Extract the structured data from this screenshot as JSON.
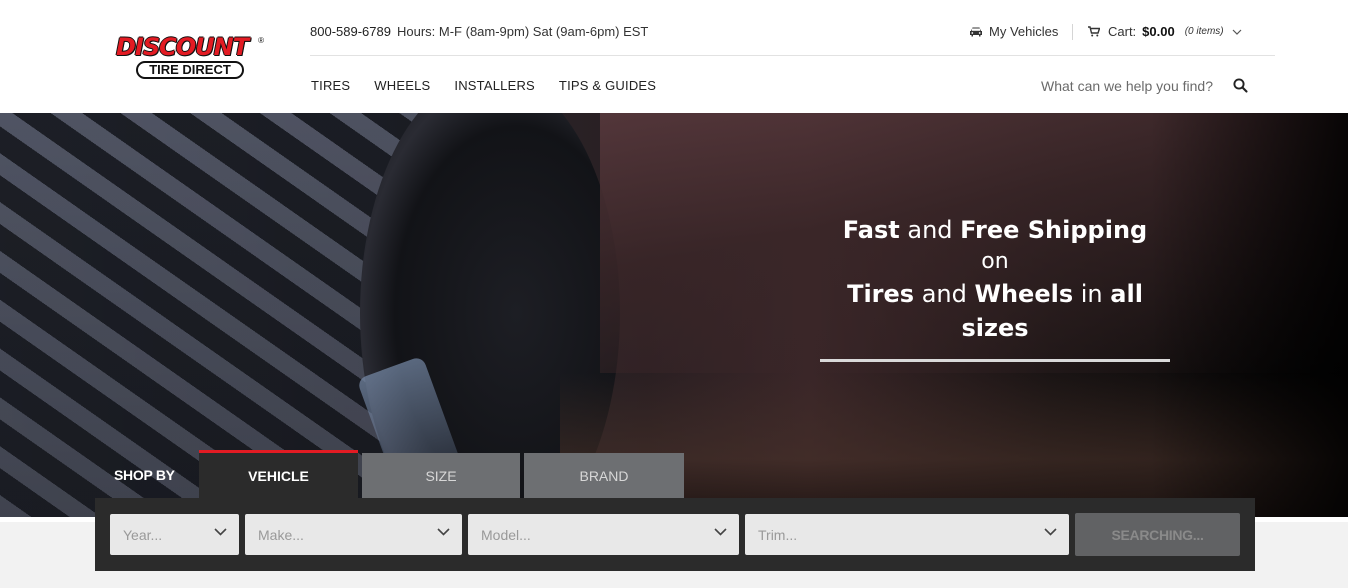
{
  "header": {
    "logo": {
      "top": "DISCOUNT",
      "bottom": "TIRE DIRECT",
      "reg": "®"
    },
    "phone": "800-589-6789",
    "hours": "Hours: M-F (8am-9pm) Sat (9am-6pm) EST",
    "my_vehicles": "My Vehicles",
    "cart": {
      "label": "Cart:",
      "amount": "$0.00",
      "items": "(0 items)"
    },
    "nav": [
      "TIRES",
      "WHEELS",
      "INSTALLERS",
      "TIPS & GUIDES"
    ],
    "search": {
      "placeholder": "What can we help you find?"
    }
  },
  "hero": {
    "line1": {
      "a": "Fast",
      "b": " and ",
      "c": "Free Shipping"
    },
    "line2": "on",
    "line3": {
      "a": "Tires",
      "b": " and ",
      "c": "Wheels",
      "d": " in ",
      "e": "all sizes"
    }
  },
  "shop": {
    "label": "SHOP BY",
    "tabs": [
      "VEHICLE",
      "SIZE",
      "BRAND"
    ],
    "active_tab": "VEHICLE",
    "selects": [
      "Year...",
      "Make...",
      "Model...",
      "Trim..."
    ],
    "button": "SEARCHING..."
  },
  "colors": {
    "brand_red": "#e31b23",
    "dark_panel": "#2b2b2b",
    "tab_inactive": "#6d6f72"
  },
  "icons": [
    "car-icon",
    "cart-icon",
    "chevron-down-icon",
    "search-icon"
  ]
}
